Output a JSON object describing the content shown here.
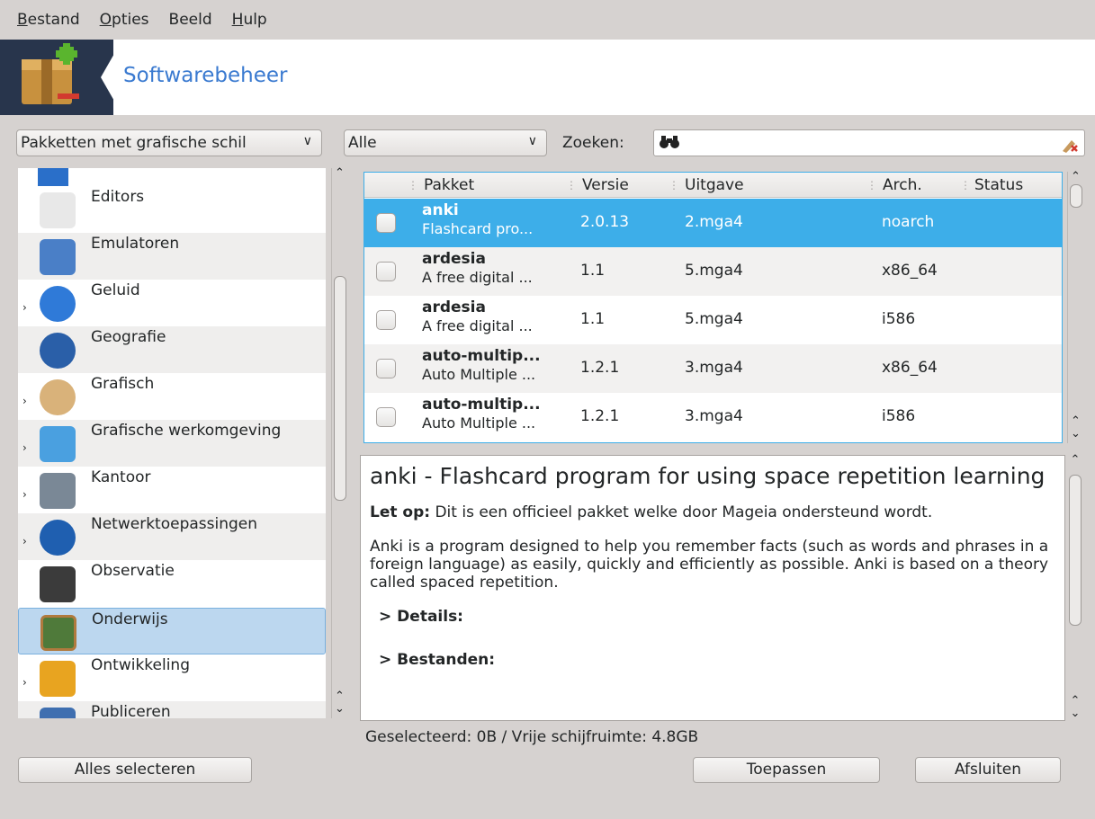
{
  "menubar": {
    "items": [
      {
        "pre": "",
        "u": "B",
        "post": "estand"
      },
      {
        "pre": "",
        "u": "O",
        "post": "pties"
      },
      {
        "pre": "Beeld",
        "u": "",
        "post": ""
      },
      {
        "pre": "",
        "u": "H",
        "post": "ulp"
      }
    ]
  },
  "banner": {
    "title": "Softwarebeheer"
  },
  "filters": {
    "type": "Pakketten met grafische schil",
    "state": "Alle",
    "search_label": "Zoeken:",
    "search_value": ""
  },
  "categories": [
    {
      "label": "Editors",
      "expandable": false
    },
    {
      "label": "Emulatoren",
      "expandable": false
    },
    {
      "label": "Geluid",
      "expandable": true
    },
    {
      "label": "Geografie",
      "expandable": false
    },
    {
      "label": "Grafisch",
      "expandable": true
    },
    {
      "label": "Grafische werkomgeving",
      "expandable": true
    },
    {
      "label": "Kantoor",
      "expandable": true
    },
    {
      "label": "Netwerktoepassingen",
      "expandable": true
    },
    {
      "label": "Observatie",
      "expandable": false
    },
    {
      "label": "Onderwijs",
      "expandable": false,
      "selected": true
    },
    {
      "label": "Ontwikkeling",
      "expandable": true
    },
    {
      "label": "Publiceren",
      "expandable": false
    }
  ],
  "table": {
    "headers": {
      "pakket": "Pakket",
      "versie": "Versie",
      "uitgave": "Uitgave",
      "arch": "Arch.",
      "status": "Status"
    },
    "rows": [
      {
        "name": "anki",
        "summary": "Flashcard pro...",
        "version": "2.0.13",
        "release": "2.mga4",
        "arch": "noarch",
        "selected": true
      },
      {
        "name": "ardesia",
        "summary": "A free digital ...",
        "version": "1.1",
        "release": "5.mga4",
        "arch": "x86_64"
      },
      {
        "name": "ardesia",
        "summary": "A free digital ...",
        "version": "1.1",
        "release": "5.mga4",
        "arch": "i586"
      },
      {
        "name": "auto-multip...",
        "summary": "Auto Multiple ...",
        "version": "1.2.1",
        "release": "3.mga4",
        "arch": "x86_64"
      },
      {
        "name": "auto-multip...",
        "summary": "Auto Multiple ...",
        "version": "1.2.1",
        "release": "3.mga4",
        "arch": "i586"
      }
    ]
  },
  "description": {
    "title": "anki - Flashcard program for using space repetition learning",
    "note_label": "Let op:",
    "note_text": " Dit is een officieel pakket welke door Mageia ondersteund wordt.",
    "body": "Anki is a program designed to help you remember facts (such as words and phrases in a foreign language) as easily, quickly and efficiently as possible. Anki is based on a theory called spaced repetition.",
    "details_label": "Details:",
    "files_label": "Bestanden:"
  },
  "status_text": "Geselecteerd: 0B / Vrije schijfruimte: 4.8GB",
  "buttons": {
    "select_all": "Alles selecteren",
    "apply": "Toepassen",
    "close": "Afsluiten"
  },
  "colors": {
    "accent": "#3daee9",
    "banner_bg": "#28354c",
    "banner_title": "#3a7ad0",
    "window_bg": "#d6d2d0"
  }
}
